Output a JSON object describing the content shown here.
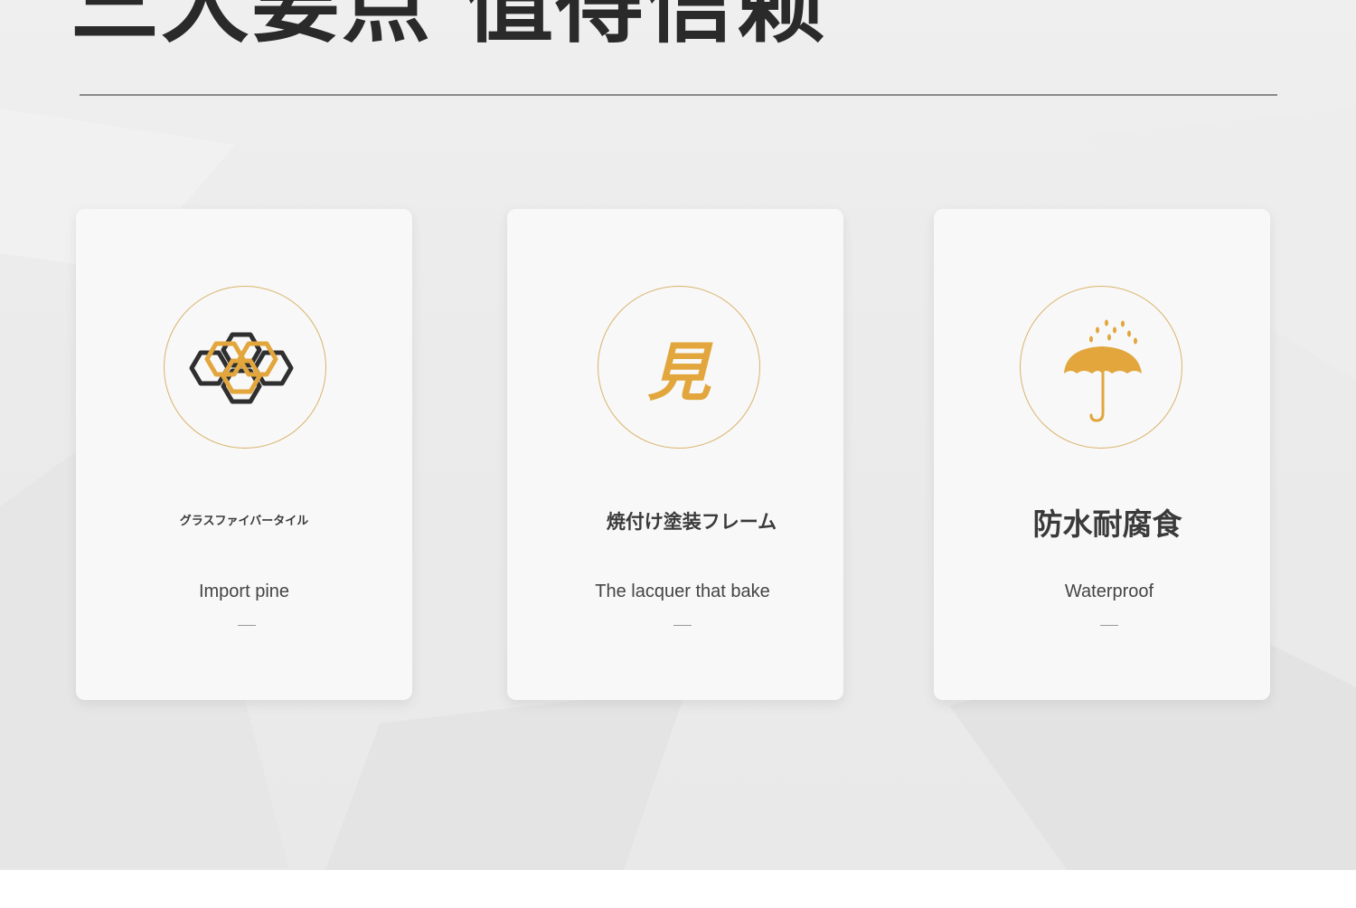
{
  "header": {
    "title": "三大要点 值得信赖"
  },
  "features": [
    {
      "icon": "honeycomb-icon",
      "title": "グラスファイバータイル",
      "subtitle": "Import pine",
      "accent": "#e2a63c"
    },
    {
      "icon": "kanji-mark-icon",
      "glyph": "見",
      "title": "焼付け塗装フレーム",
      "subtitle": "The lacquer that bake",
      "accent": "#e2a63c"
    },
    {
      "icon": "umbrella-rain-icon",
      "title": "防水耐腐食",
      "subtitle": "Waterproof",
      "accent": "#e2a63c"
    }
  ],
  "colors": {
    "gold": "#e2a63c",
    "ring": "#d9b36a",
    "dark": "#2a2a2a",
    "background": "#ececec",
    "card": "#f8f8f8"
  }
}
